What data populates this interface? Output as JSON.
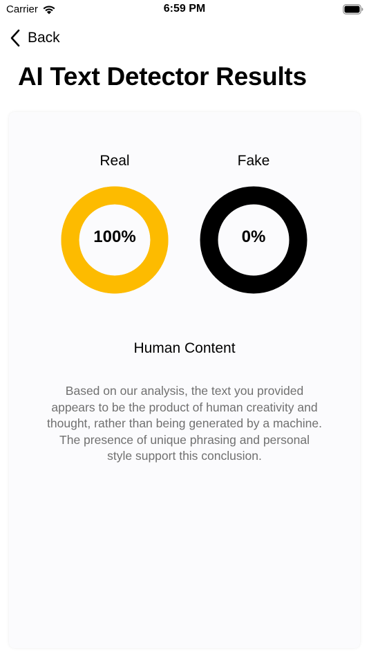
{
  "status_bar": {
    "carrier": "Carrier",
    "time": "6:59 PM"
  },
  "nav": {
    "back_label": "Back"
  },
  "page": {
    "title": "AI Text Detector Results"
  },
  "results": {
    "real": {
      "label": "Real",
      "value_text": "100%",
      "fraction": 1.0,
      "color": "#FDBB00"
    },
    "fake": {
      "label": "Fake",
      "value_text": "0%",
      "fraction": 0.0,
      "color": "#000000"
    },
    "heading": "Human Content",
    "description": "Based on our analysis, the text you provided appears to be the product of human creativity and thought, rather than being generated by a machine. The presence of unique phrasing and personal style support this conclusion."
  }
}
